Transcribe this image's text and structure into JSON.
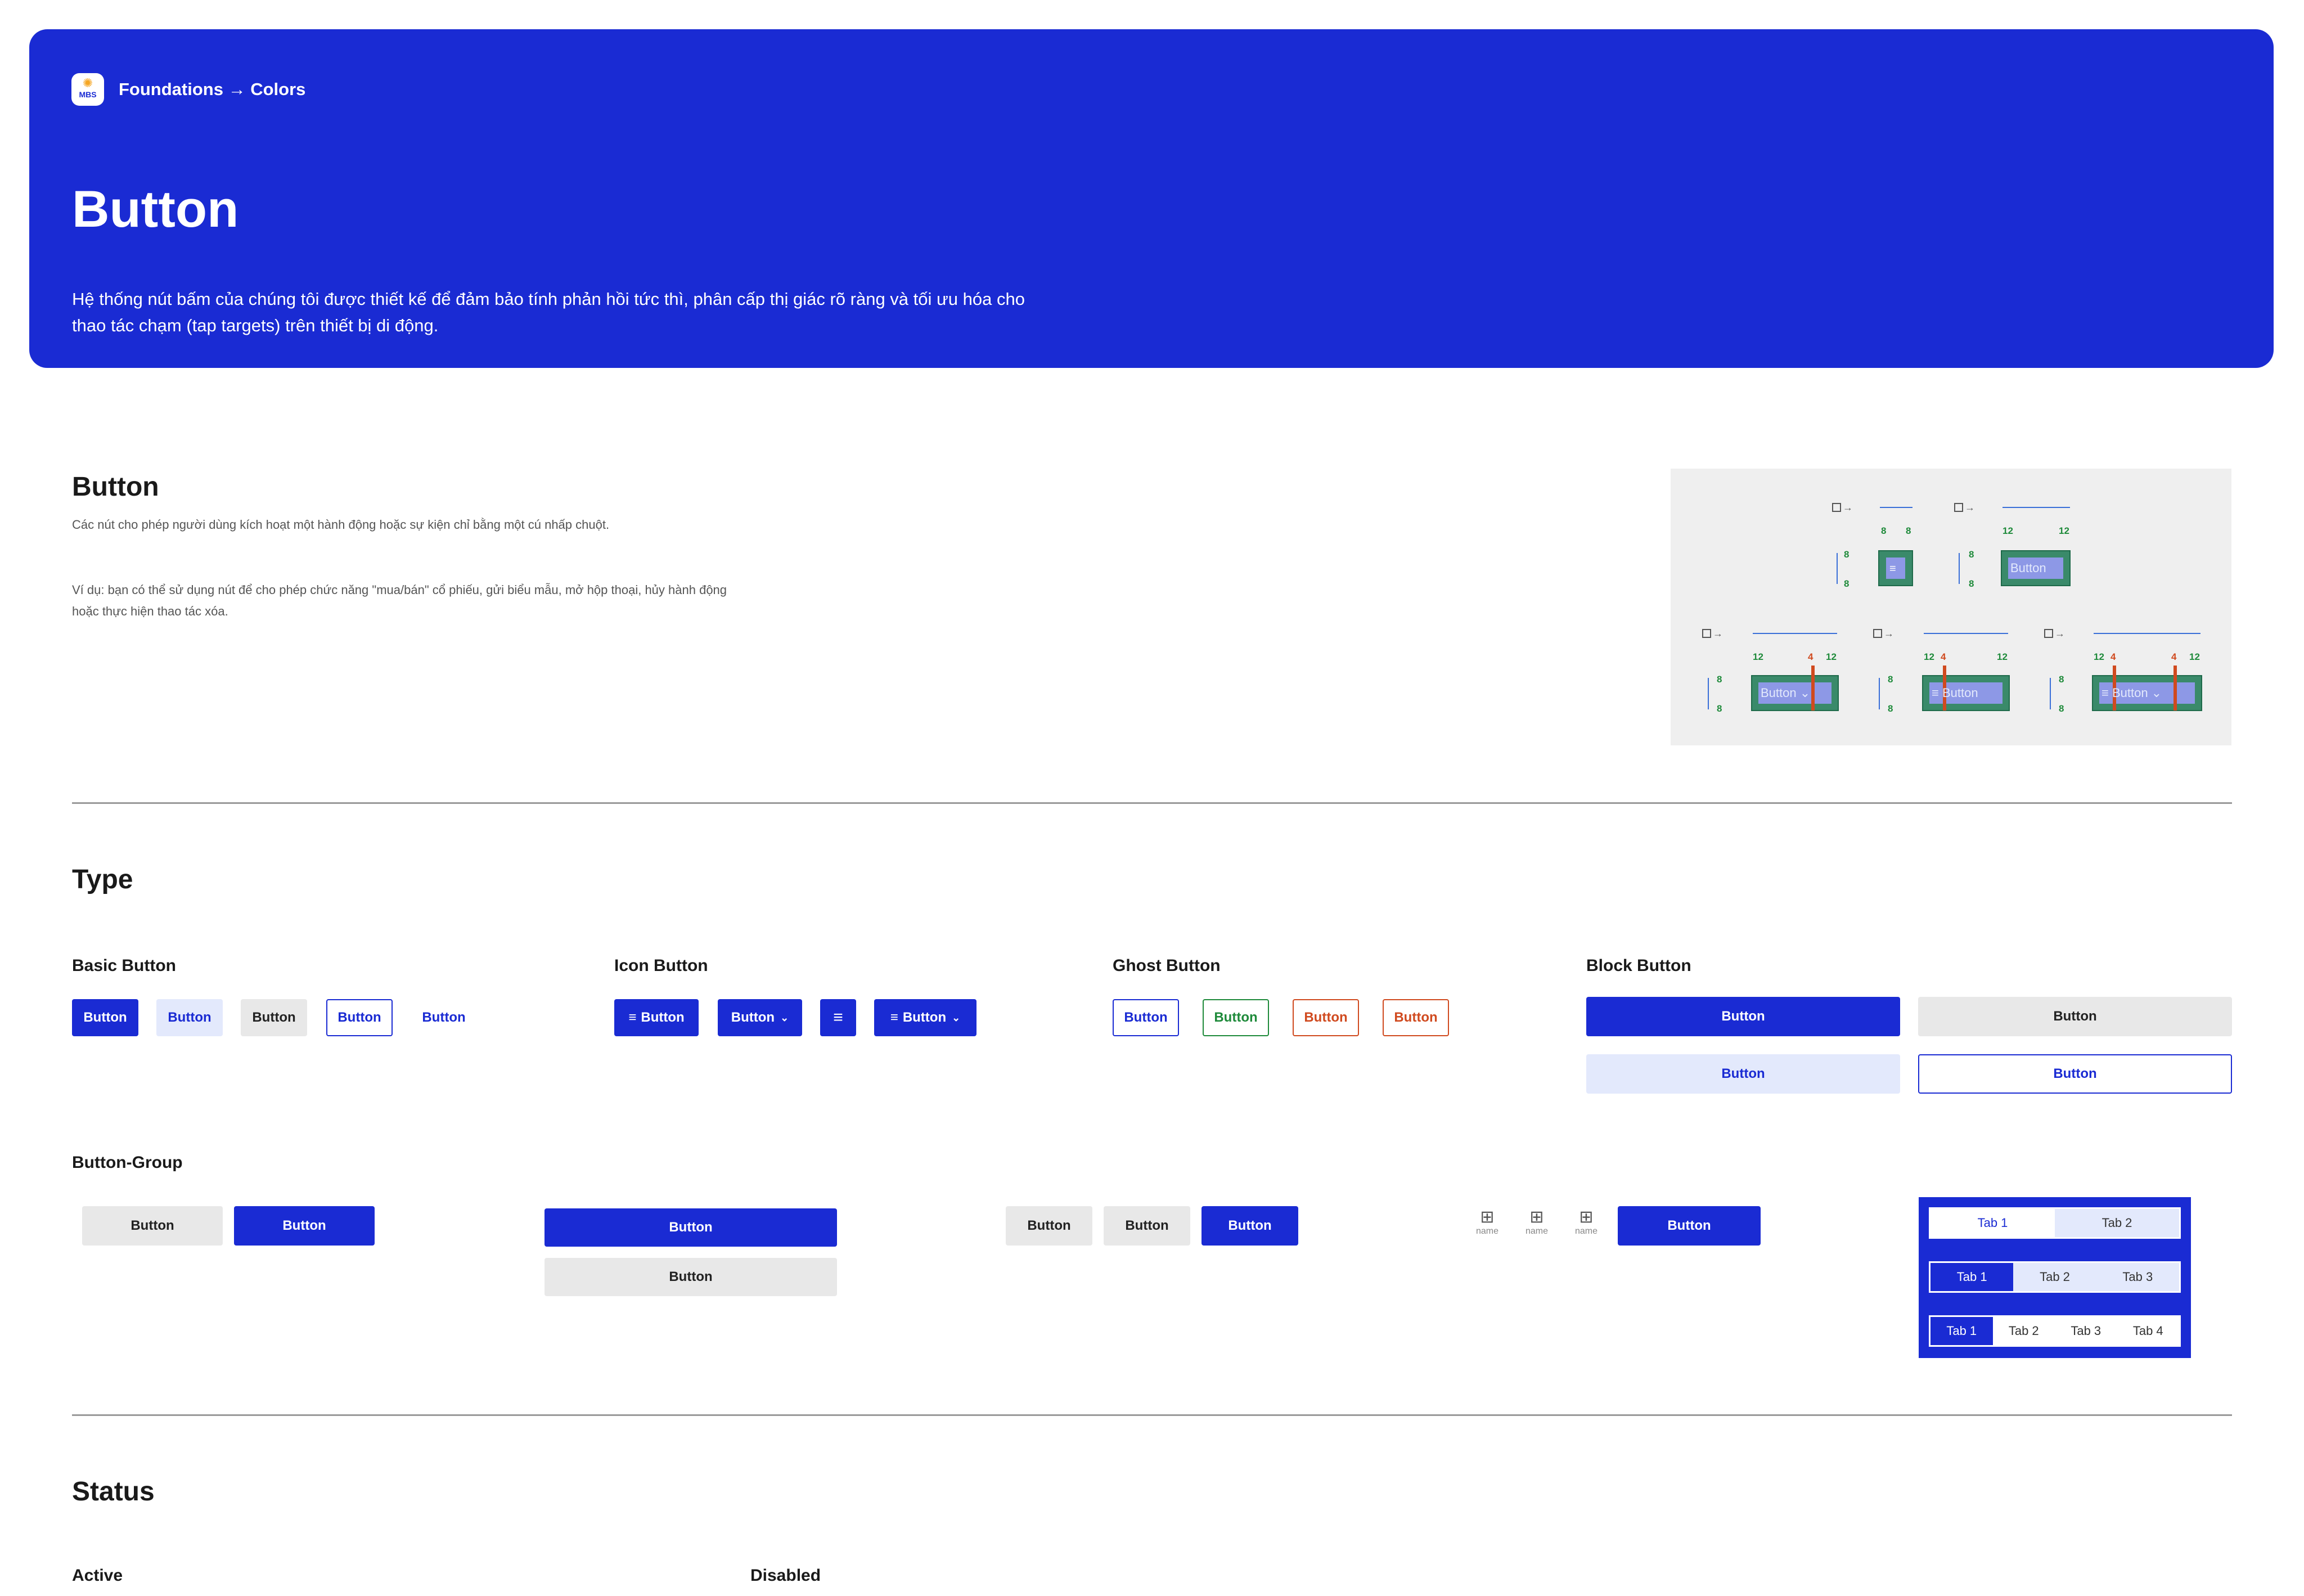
{
  "hero": {
    "logo_text": "MBS",
    "breadcrumb": "Foundations → Colors",
    "title": "Button",
    "description": "Hệ thống nút bấm của chúng tôi được thiết kế để đảm bảo tính phản hồi tức thì, phân cấp thị giác rõ ràng và tối ưu hóa cho thao tác chạm (tap targets) trên thiết bị di động."
  },
  "intro": {
    "title": "Button",
    "para1": "Các nút cho phép người dùng kích hoạt một hành động hoặc sự kiện chỉ bằng một cú nhấp chuột.",
    "para2": "Ví dụ: bạn có thể sử dụng nút để cho phép chức năng \"mua/bán\" cổ phiếu, gửi biểu mẫu, mở hộp thoại, hủy hành động hoặc thực hiện thao tác xóa."
  },
  "anatomy": {
    "button_label": "Button",
    "spacing_8": "8",
    "spacing_12": "12",
    "spacing_4": "4"
  },
  "type": {
    "title": "Type",
    "basic": {
      "title": "Basic Button",
      "buttons": [
        "Button",
        "Button",
        "Button",
        "Button",
        "Button"
      ]
    },
    "icon": {
      "title": "Icon Button",
      "buttons": [
        "Button",
        "Button",
        "Button"
      ]
    },
    "ghost": {
      "title": "Ghost Button",
      "buttons": [
        "Button",
        "Button",
        "Button",
        "Button"
      ]
    },
    "block": {
      "title": "Block Button",
      "buttons": [
        "Button",
        "Button",
        "Button",
        "Button"
      ]
    }
  },
  "group": {
    "title": "Button-Group",
    "pair": [
      "Button",
      "Button"
    ],
    "stack": [
      "Button",
      "Button"
    ],
    "triple": [
      "Button",
      "Button",
      "Button"
    ],
    "icon_label": "name",
    "icon_action": "Button",
    "tabs2": [
      "Tab 1",
      "Tab 2"
    ],
    "tabs3": [
      "Tab 1",
      "Tab 2",
      "Tab 3"
    ],
    "tabs4": [
      "Tab 1",
      "Tab 2",
      "Tab 3",
      "Tab 4"
    ]
  },
  "status": {
    "title": "Status",
    "active": "Active",
    "disabled": "Disabled"
  },
  "colors": {
    "primary": "#1a2bd3",
    "light": "#e3e9fc",
    "gray": "#e8e8e8",
    "success": "#1e8a3a",
    "danger": "#d04a1f"
  }
}
